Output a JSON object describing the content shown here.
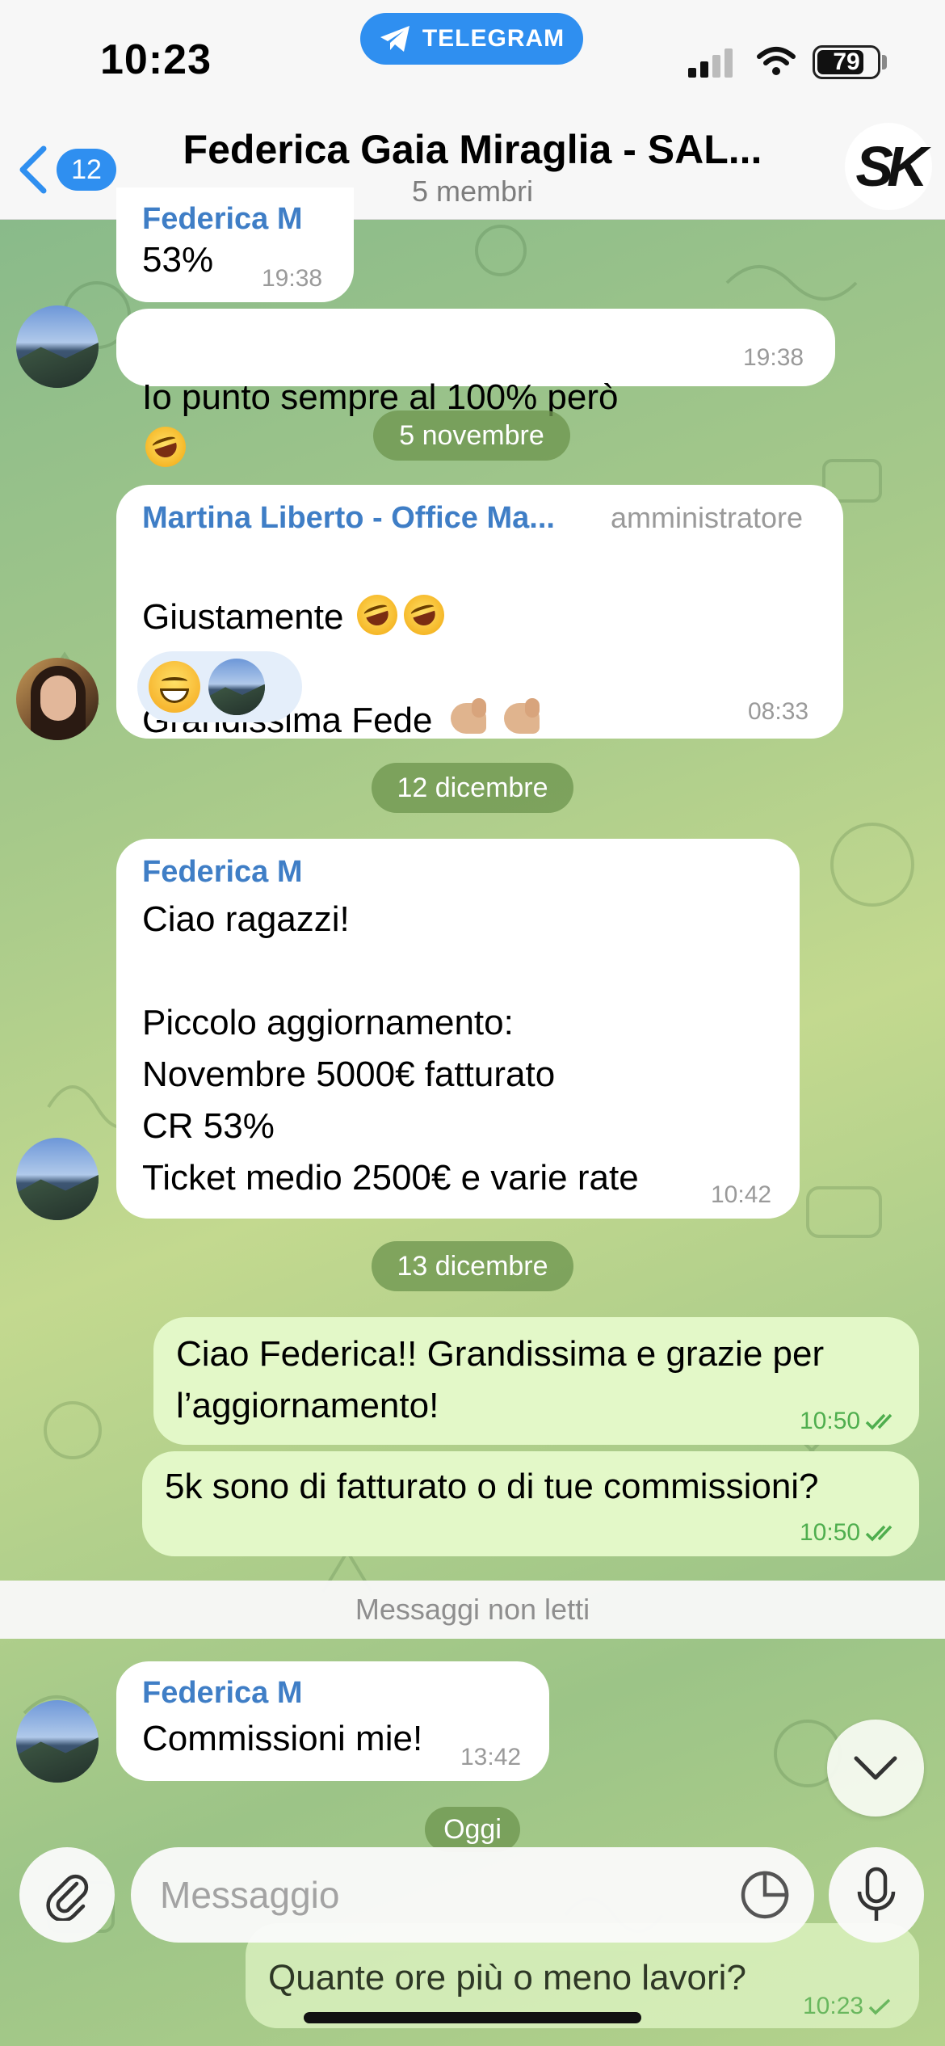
{
  "status_bar": {
    "time": "10:23",
    "app_pill": "TELEGRAM",
    "battery": "79",
    "battery_level": 0.79
  },
  "header": {
    "back_count": "12",
    "title": "Federica Gaia Miraglia - SAL...",
    "subtitle": "5 membri",
    "group_avatar_text": "SK"
  },
  "messages": {
    "m0": {
      "sender": "Federica M",
      "text": "53%",
      "time": "19:38"
    },
    "m1": {
      "text": "Io punto sempre al 100% però",
      "time": "19:38"
    },
    "date1": "5 novembre",
    "m2": {
      "sender": "Martina Liberto - Office Ma...",
      "role": "amministratore",
      "line1": "Giustamente",
      "line2": "Grandissima Fede",
      "time": "08:33"
    },
    "date2": "12 dicembre",
    "m3": {
      "sender": "Federica M",
      "text": "Ciao ragazzi!\n\nPiccolo aggiornamento:\nNovembre 5000€ fatturato\nCR 53%\nTicket medio 2500€ e varie rate",
      "time": "10:42"
    },
    "date3": "13 dicembre",
    "m4": {
      "text": "Ciao Federica!! Grandissima e grazie per\nl’aggiornamento!",
      "time": "10:50"
    },
    "m5": {
      "text": "5k sono di fatturato o di tue commissioni?",
      "time": "10:50"
    },
    "unread": "Messaggi non letti",
    "m6": {
      "sender": "Federica M",
      "text": "Commissioni mie!",
      "time": "13:42"
    },
    "date4": "Oggi",
    "m7": {
      "text": "Quante ore più o meno lavori?",
      "time": "10:23"
    }
  },
  "input": {
    "placeholder": "Messaggio"
  },
  "colors": {
    "accent": "#2f8ff0",
    "sender_name": "#3f7ec6",
    "outgoing_bubble": "#e3f8c8",
    "read_check": "#4fae4e"
  }
}
